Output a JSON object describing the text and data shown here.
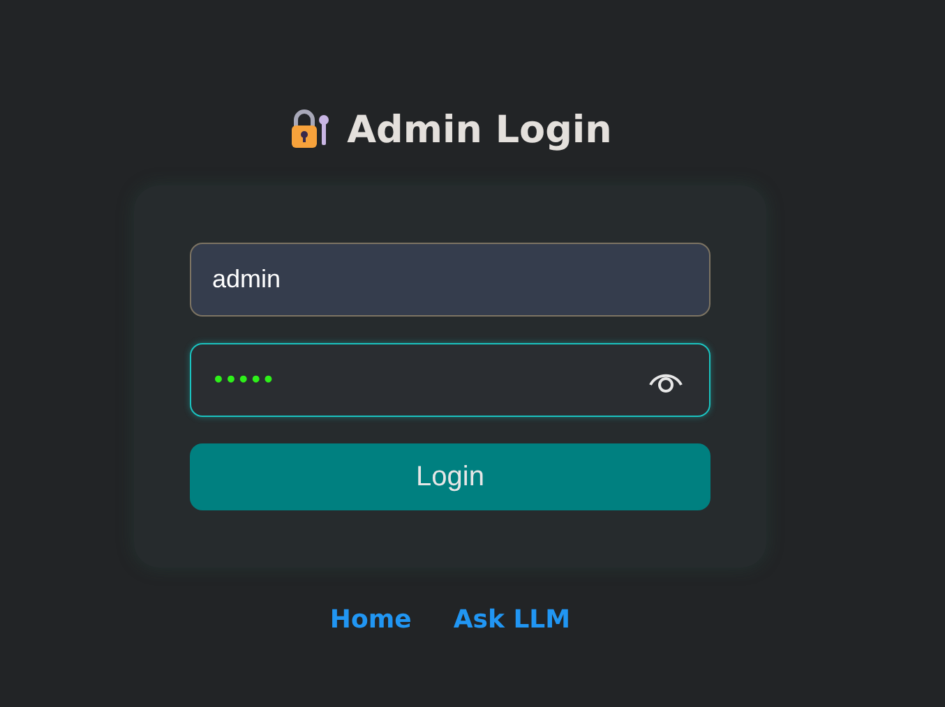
{
  "title": "Admin Login",
  "username": {
    "value": "admin"
  },
  "password": {
    "value": "•••••",
    "focused": true
  },
  "login_button": "Login",
  "links": [
    "Home",
    "Ask LLM"
  ]
}
